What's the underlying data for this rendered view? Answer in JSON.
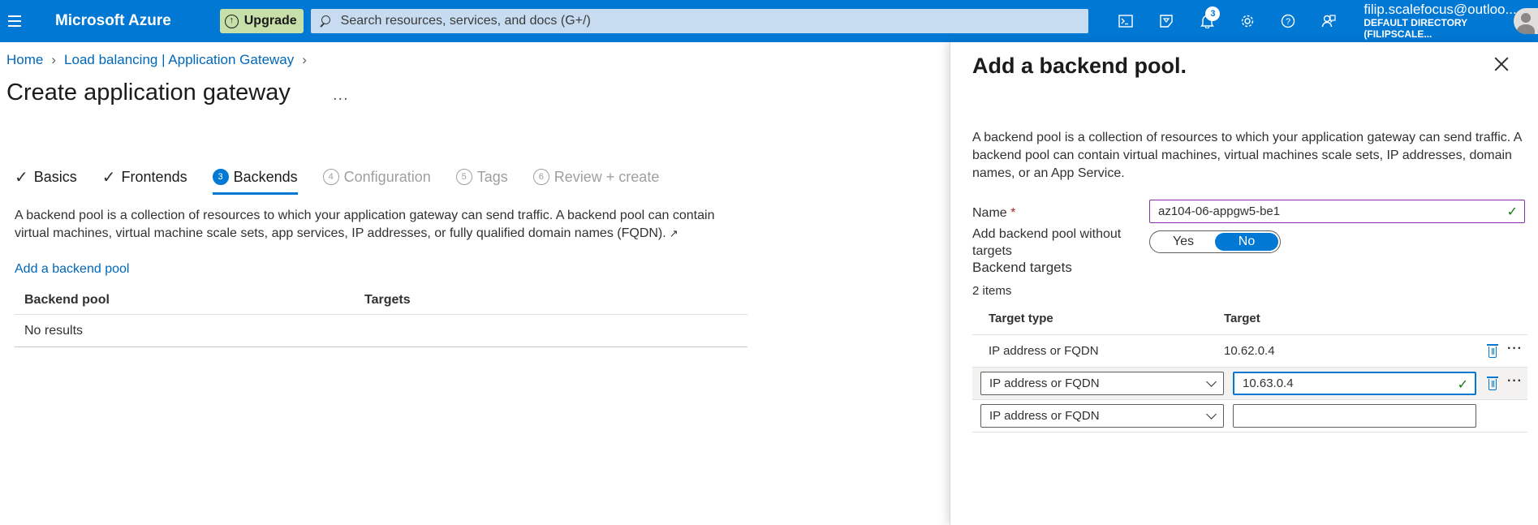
{
  "topbar": {
    "brand": "Microsoft Azure",
    "upgrade_label": "Upgrade",
    "search_placeholder": "Search resources, services, and docs (G+/)",
    "notification_count": "3",
    "account_email": "filip.scalefocus@outloo...",
    "account_directory": "DEFAULT DIRECTORY (FILIPSCALE..."
  },
  "breadcrumb": {
    "home": "Home",
    "parent": "Load balancing | Application Gateway"
  },
  "page": {
    "title": "Create application gateway",
    "more": "...",
    "description": "A backend pool is a collection of resources to which your application gateway can send traffic. A backend pool can contain virtual machines, virtual machine scale sets, app services, IP addresses, or fully qualified domain names (FQDN).",
    "add_pool_link": "Add a backend pool"
  },
  "tabs": [
    {
      "label": "Basics",
      "num": "",
      "state": "done"
    },
    {
      "label": "Frontends",
      "num": "",
      "state": "done"
    },
    {
      "label": "Backends",
      "num": "3",
      "state": "active"
    },
    {
      "label": "Configuration",
      "num": "4",
      "state": "disabled"
    },
    {
      "label": "Tags",
      "num": "5",
      "state": "disabled"
    },
    {
      "label": "Review + create",
      "num": "6",
      "state": "disabled"
    }
  ],
  "pool_table": {
    "col_pool": "Backend pool",
    "col_targets": "Targets",
    "empty": "No results"
  },
  "panel": {
    "title": "Add a backend pool.",
    "description": "A backend pool is a collection of resources to which your application gateway can send traffic. A backend pool can contain virtual machines, virtual machines scale sets, IP addresses, domain names, or an App Service.",
    "name_label": "Name",
    "name_required": "*",
    "name_value": "az104-06-appgw5-be1",
    "no_targets_label": "Add backend pool without targets",
    "toggle_yes": "Yes",
    "toggle_no": "No",
    "targets_title": "Backend targets",
    "items_count": "2 items",
    "col_type": "Target type",
    "col_target": "Target",
    "rows": [
      {
        "type": "IP address or FQDN",
        "target": "10.62.0.4"
      },
      {
        "type": "IP address or FQDN",
        "target": "10.63.0.4"
      },
      {
        "type": "IP address or FQDN",
        "target": ""
      }
    ]
  },
  "colors": {
    "azure_blue": "#0078d4",
    "upgrade_green": "#c7e0a9",
    "valid_check": "#107c10"
  }
}
